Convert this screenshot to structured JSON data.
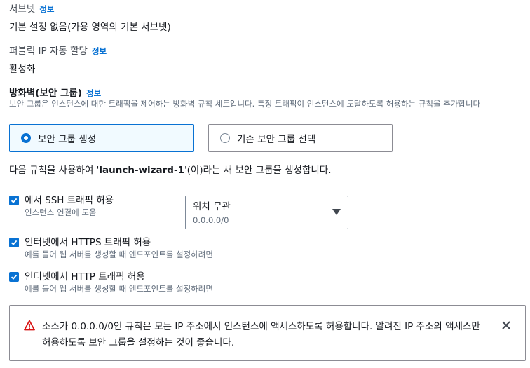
{
  "subnet": {
    "label": "서브넷",
    "info": "정보",
    "value": "기본 설정 없음(가용 영역의 기본 서브넷)"
  },
  "public_ip": {
    "label": "퍼블릭 IP 자동 할당",
    "info": "정보",
    "value": "활성화"
  },
  "firewall": {
    "label": "방화벽(보안 그룹)",
    "info": "정보",
    "description": "보안 그룹은 인스턴스에 대한 트래픽을 제어하는 방화벽 규칙 세트입니다. 특정 트래픽이 인스턴스에 도달하도록 허용하는 규칙을 추가합니다",
    "option_create": "보안 그룹 생성",
    "option_select": "기존 보안 그룹 선택",
    "selected": "create"
  },
  "rule_text": {
    "prefix": "다음 규칙을 사용하여 '",
    "group_name": "launch-wizard-1",
    "suffix": "'(이)라는 새 보안 그룹을 생성합니다."
  },
  "rules": [
    {
      "label": "에서 SSH 트래픽 허용",
      "sublabel": "인스턴스 연결에 도움",
      "checked": true
    },
    {
      "label": "인터넷에서 HTTPS 트래픽 허용",
      "sublabel": "예를 들어 웹 서버를 생성할 때 엔드포인트를 설정하려면",
      "checked": true
    },
    {
      "label": "인터넷에서 HTTP 트래픽 허용",
      "sublabel": "예를 들어 웹 서버를 생성할 때 엔드포인트를 설정하려면",
      "checked": true
    }
  ],
  "ssh_source": {
    "selected": "위치 무관",
    "cidr": "0.0.0.0/0"
  },
  "alert": {
    "type": "warning",
    "message": "소스가 0.0.0.0/0인 규칙은 모든 IP 주소에서 인스턴스에 액세스하도록 허용합니다. 알려진 IP 주소의 액세스만 허용하도록 보안 그룹을 설정하는 것이 좋습니다."
  },
  "colors": {
    "accent": "#0972d3",
    "warning": "#d91515",
    "text": "#16191f",
    "muted": "#5f6b7a"
  },
  "icons": {
    "warning": "warning-icon",
    "close": "close-icon",
    "check": "check-icon",
    "caret": "caret-down-icon"
  }
}
